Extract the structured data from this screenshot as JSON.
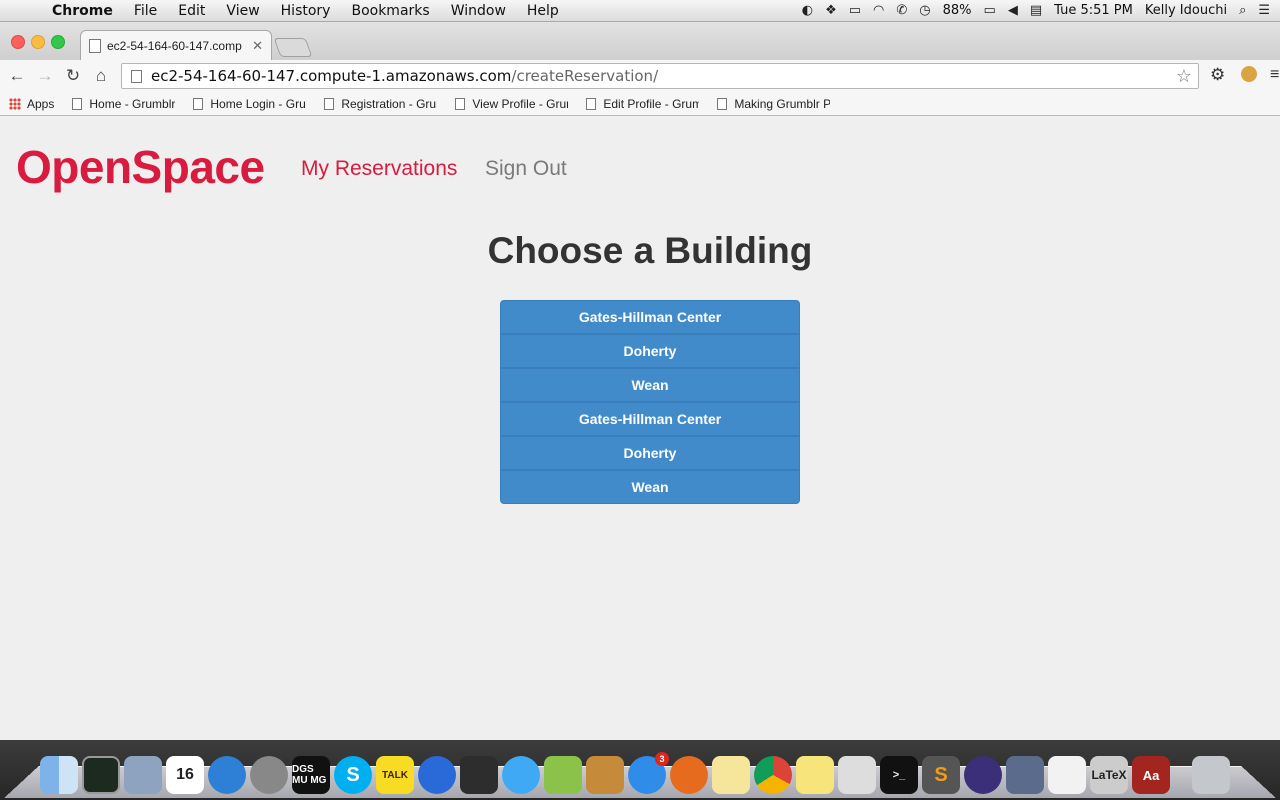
{
  "menubar": {
    "app_name": "Chrome",
    "menus": [
      "File",
      "Edit",
      "View",
      "History",
      "Bookmarks",
      "Window",
      "Help"
    ],
    "battery": "88%",
    "clock": "Tue 5:51 PM",
    "user": "Kelly Idouchi"
  },
  "browser": {
    "tab_title": "ec2-54-164-60-147.comp",
    "url_host": "ec2-54-164-60-147.compute-1.amazonaws.com",
    "url_path": "/createReservation/",
    "bookmarks": [
      "Apps",
      "Home - Grumblr",
      "Home Login - Grumbl",
      "Registration - Grumb",
      "View Profile - Grumb",
      "Edit Profile - Grumbl",
      "Making Grumblr Pos"
    ]
  },
  "site": {
    "brand": "OpenSpace",
    "nav": {
      "reservations": "My Reservations",
      "signout": "Sign Out"
    },
    "heading": "Choose a Building",
    "buildings": [
      "Gates-Hillman Center",
      "Doherty",
      "Wean",
      "Gates-Hillman Center",
      "Doherty",
      "Wean"
    ]
  },
  "dock": {
    "calendar_day": "16",
    "dgs_label": "DGS MU MG",
    "talk_label": "TALK",
    "skype_label": "S",
    "sublime_label": "S",
    "terminal_label": ">_",
    "latex_label": "LaTeX",
    "dictionary_label": "Aa",
    "appstore_badge": "3"
  },
  "colors": {
    "brand": "#d81b3f",
    "button": "#428bca",
    "page_bg": "#efefef"
  }
}
